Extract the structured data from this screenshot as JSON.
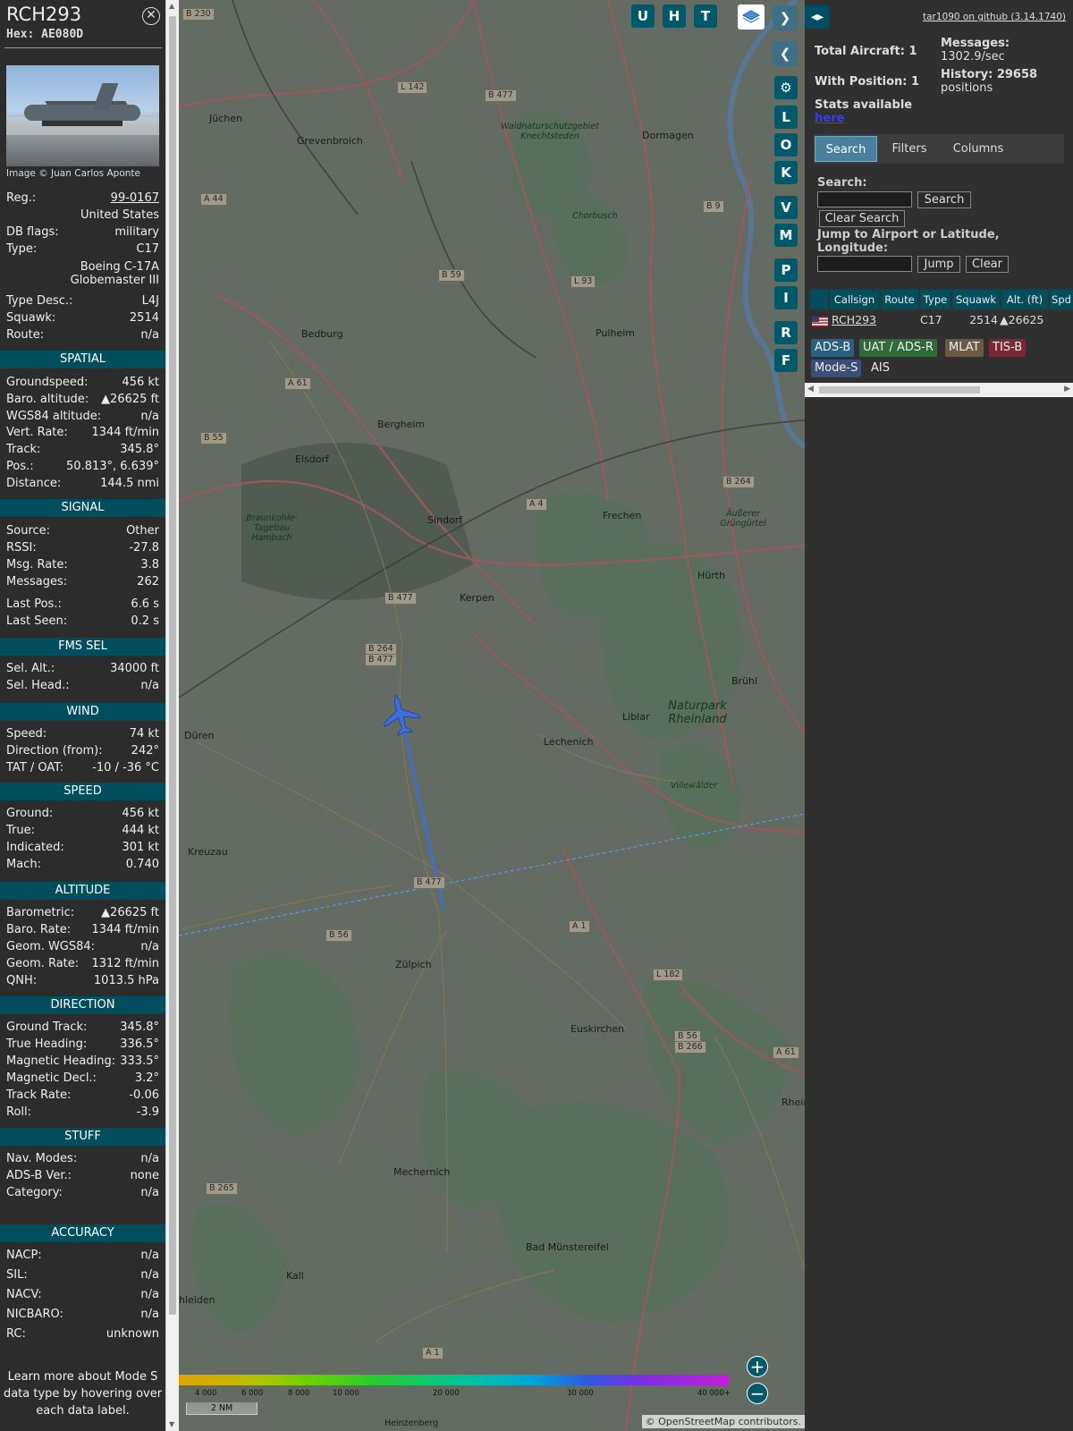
{
  "aircraft": {
    "callsign": "RCH293",
    "hex_label": "Hex:",
    "hex": "AE080D",
    "image_credit": "Image © Juan Carlos Aponte",
    "rows": [
      {
        "k": "Reg.:",
        "v": "99-0167"
      },
      {
        "k": "",
        "v": "United States"
      },
      {
        "k": "DB flags:",
        "v": "military"
      },
      {
        "k": "Type:",
        "v": "C17"
      },
      {
        "k": "",
        "v": "Boeing C-17A Globemaster III"
      },
      {
        "k": "Type Desc.:",
        "v": "L4J"
      },
      {
        "k": "Squawk:",
        "v": "2514"
      },
      {
        "k": "Route:",
        "v": "n/a"
      }
    ]
  },
  "sections": {
    "spatial": {
      "title": "SPATIAL",
      "rows": [
        {
          "k": "Groundspeed:",
          "v": "456 kt"
        },
        {
          "k": "Baro. altitude:",
          "v": "▲26625 ft"
        },
        {
          "k": "WGS84 altitude:",
          "v": "n/a"
        },
        {
          "k": "Vert. Rate:",
          "v": "1344 ft/min"
        },
        {
          "k": "Track:",
          "v": "345.8°"
        },
        {
          "k": "Pos.:",
          "v": "50.813°, 6.639°"
        },
        {
          "k": "Distance:",
          "v": "144.5 nmi"
        }
      ]
    },
    "signal": {
      "title": "SIGNAL",
      "rows": [
        {
          "k": "Source:",
          "v": "Other"
        },
        {
          "k": "RSSI:",
          "v": "-27.8"
        },
        {
          "k": "Msg. Rate:",
          "v": "3.8"
        },
        {
          "k": "Messages:",
          "v": "262"
        },
        {
          "k": "Last Pos.:",
          "v": "6.6 s"
        },
        {
          "k": "Last Seen:",
          "v": "0.2 s"
        }
      ]
    },
    "fms": {
      "title": "FMS SEL",
      "rows": [
        {
          "k": "Sel. Alt.:",
          "v": "34000 ft"
        },
        {
          "k": "Sel. Head.:",
          "v": "n/a"
        }
      ]
    },
    "wind": {
      "title": "WIND",
      "rows": [
        {
          "k": "Speed:",
          "v": "74 kt"
        },
        {
          "k": "Direction (from):",
          "v": "242°"
        },
        {
          "k": "TAT / OAT:",
          "v": "-10 / -36 °C"
        }
      ]
    },
    "speed": {
      "title": "SPEED",
      "rows": [
        {
          "k": "Ground:",
          "v": "456 kt"
        },
        {
          "k": "True:",
          "v": "444 kt"
        },
        {
          "k": "Indicated:",
          "v": "301 kt"
        },
        {
          "k": "Mach:",
          "v": "0.740"
        }
      ]
    },
    "altitude": {
      "title": "ALTITUDE",
      "rows": [
        {
          "k": "Barometric:",
          "v": "▲26625 ft"
        },
        {
          "k": "Baro. Rate:",
          "v": "1344 ft/min"
        },
        {
          "k": "Geom. WGS84:",
          "v": "n/a"
        },
        {
          "k": "Geom. Rate:",
          "v": "1312 ft/min"
        },
        {
          "k": "QNH:",
          "v": "1013.5 hPa"
        }
      ]
    },
    "direction": {
      "title": "DIRECTION",
      "rows": [
        {
          "k": "Ground Track:",
          "v": "345.8°"
        },
        {
          "k": "True Heading:",
          "v": "336.5°"
        },
        {
          "k": "Magnetic Heading:",
          "v": "333.5°"
        },
        {
          "k": "Magnetic Decl.:",
          "v": "3.2°"
        },
        {
          "k": "Track Rate:",
          "v": "-0.06"
        },
        {
          "k": "Roll:",
          "v": "-3.9"
        }
      ]
    },
    "stuff": {
      "title": "STUFF",
      "rows": [
        {
          "k": "Nav. Modes:",
          "v": "n/a"
        },
        {
          "k": "ADS-B Ver.:",
          "v": "none"
        },
        {
          "k": "Category:",
          "v": "n/a"
        }
      ]
    },
    "accuracy": {
      "title": "ACCURACY",
      "rows": [
        {
          "k": "NACP:",
          "v": "n/a"
        },
        {
          "k": "SIL:",
          "v": "n/a"
        },
        {
          "k": "NACV:",
          "v": "n/a"
        },
        {
          "k": "NICBARO:",
          "v": "n/a"
        },
        {
          "k": "RC:",
          "v": "unknown"
        }
      ]
    }
  },
  "learn_more": "Learn more about Mode S data type by hovering over each data label.",
  "map": {
    "buttons": [
      "U",
      "H",
      "T"
    ],
    "side_buttons": [
      "L",
      "O",
      "K",
      "V",
      "M",
      "P",
      "I",
      "R",
      "F"
    ],
    "places": [
      "Jüchen",
      "Grevenbroich",
      "Dormagen",
      "Bedburg",
      "Pulheim",
      "Bergheim",
      "Elsdorf",
      "Sindorf",
      "Frechen",
      "Kerpen",
      "Hürth",
      "Brühl",
      "Düren",
      "Liblar",
      "Lechenich",
      "Kreuzau",
      "Zülpich",
      "Euskirchen",
      "Mechernich",
      "Bad Münstereifel",
      "Kall",
      "hleiden",
      "Heinzenberg",
      "Rhein"
    ],
    "roads": [
      "B 230",
      "L 142",
      "B 477",
      "B 9",
      "A 44",
      "B 59",
      "L 93",
      "A 61",
      "B 55",
      "A 4",
      "B 264",
      "B 477",
      "B 264",
      "B 477",
      "B 477",
      "A 1",
      "B 56",
      "L 182",
      "B 56",
      "B 266",
      "A 61",
      "B 265",
      "A 1"
    ],
    "forests": [
      "Waldnaturschutzgebiet Knechtsteden",
      "Chorbusch",
      "Braunkohle-Tagebau Hambach",
      "Äußerer Grüngürtel",
      "Villewälder"
    ],
    "park": "Naturpark Rheinland",
    "colorbar_ticks": [
      "4 000",
      "6 000",
      "8 000",
      "10 000",
      "20 000",
      "30 000",
      "40 000+"
    ],
    "scale": "2 NM",
    "attribution": "© OpenStreetMap contributors.",
    "zoom_in": "+",
    "zoom_out": "−"
  },
  "sidebar": {
    "github": "tar1090 on github (3.14.1740)",
    "total_aircraft": "Total Aircraft: 1",
    "with_position": "With Position: 1",
    "messages_label": "Messages:",
    "messages_value": "1302.9/sec",
    "history_label": "History: 29658",
    "history_value": "positions",
    "stats_text": "Stats available",
    "stats_link": "here",
    "tabs": [
      "Search",
      "Filters",
      "Columns"
    ],
    "search_label": "Search:",
    "search_button": "Search",
    "clear_search_button": "Clear Search",
    "jump_label": "Jump to Airport or Latitude, Longitude:",
    "jump_button": "Jump",
    "clear_button": "Clear",
    "table_headers": [
      "",
      "Callsign",
      "Route",
      "Type",
      "Squawk",
      "Alt. (ft)",
      "Spd"
    ],
    "table_row": {
      "callsign": "RCH293",
      "type": "C17",
      "squawk": "2514",
      "alt": "▲26625"
    },
    "sources": [
      {
        "label": "ADS-B",
        "color": "#2a5f7f"
      },
      {
        "label": "UAT / ADS-R",
        "color": "#2f6a38"
      },
      {
        "label": "MLAT",
        "color": "#6a5a44"
      },
      {
        "label": "TIS-B",
        "color": "#7a2a36"
      },
      {
        "label": "Mode-S",
        "color": "#3b4e7a"
      },
      {
        "label": "AIS",
        "color": "#303030"
      }
    ]
  }
}
